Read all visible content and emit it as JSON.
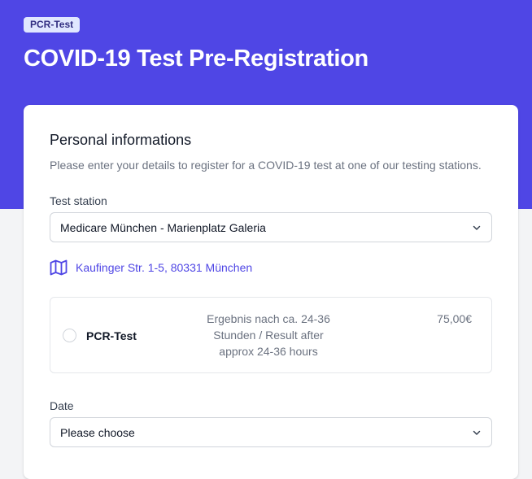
{
  "header": {
    "badge": "PCR-Test",
    "title": "COVID-19 Test Pre-Registration"
  },
  "personal": {
    "heading": "Personal informations",
    "description": "Please enter your details to register for a COVID-19 test at one of our testing stations."
  },
  "station": {
    "label": "Test station",
    "selected": "Medicare München - Marienplatz Galeria",
    "address": "Kaufinger Str. 1-5, 80331 München"
  },
  "test_option": {
    "name": "PCR-Test",
    "description": "Ergebnis nach ca. 24-36 Stunden / Result after approx 24-36 hours",
    "price": "75,00€",
    "selected": false
  },
  "date": {
    "label": "Date",
    "selected": "Please choose"
  },
  "colors": {
    "accent": "#4f46e5",
    "badge_bg": "#e0e7ff",
    "page_bg": "#f3f4f6"
  },
  "icons": {
    "map": "map-icon",
    "chevron": "chevron-down-icon"
  }
}
